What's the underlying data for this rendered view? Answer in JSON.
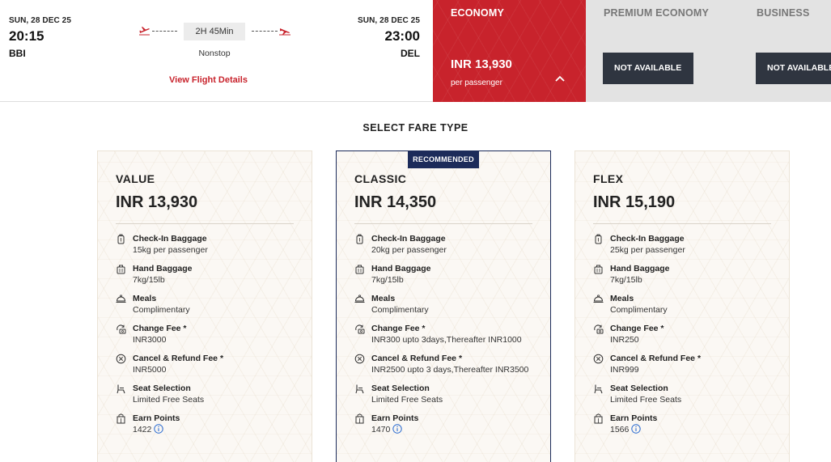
{
  "flight": {
    "departure": {
      "date": "SUN, 28 DEC 25",
      "time": "20:15",
      "code": "BBI"
    },
    "arrival": {
      "date": "SUN, 28 DEC 25",
      "time": "23:00",
      "code": "DEL"
    },
    "duration": "2H 45Min",
    "stops": "Nonstop",
    "details_link": "View Flight Details"
  },
  "classes": {
    "economy": {
      "title": "ECONOMY",
      "price": "INR 13,930",
      "sub": "per passenger"
    },
    "premium": {
      "title": "PREMIUM ECONOMY",
      "button": "NOT AVAILABLE"
    },
    "business": {
      "title": "BUSINESS",
      "button": "NOT AVAILABLE"
    }
  },
  "section_title": "SELECT FARE TYPE",
  "colors": {
    "brand_red": "#c8232c",
    "navy": "#1c2b5a",
    "dark_button": "#2f3540"
  },
  "cards": [
    {
      "name": "VALUE",
      "price": "INR 13,930",
      "badge": "",
      "features": [
        {
          "icon": "bag-icon",
          "label": "Check-In Baggage",
          "value": "15kg per passenger"
        },
        {
          "icon": "hand-bag-icon",
          "label": "Hand Baggage",
          "value": "7kg/15lb"
        },
        {
          "icon": "meal-icon",
          "label": "Meals",
          "value": "Complimentary"
        },
        {
          "icon": "change-fee-icon",
          "label": "Change Fee *",
          "value": "INR3000"
        },
        {
          "icon": "cancel-icon",
          "label": "Cancel & Refund Fee *",
          "value": "INR5000"
        },
        {
          "icon": "seat-icon",
          "label": "Seat Selection",
          "value": "Limited Free Seats"
        },
        {
          "icon": "points-icon",
          "label": "Earn Points",
          "value": "1422"
        }
      ]
    },
    {
      "name": "CLASSIC",
      "price": "INR 14,350",
      "badge": "RECOMMENDED",
      "features": [
        {
          "icon": "bag-icon",
          "label": "Check-In Baggage",
          "value": "20kg per passenger"
        },
        {
          "icon": "hand-bag-icon",
          "label": "Hand Baggage",
          "value": "7kg/15lb"
        },
        {
          "icon": "meal-icon",
          "label": "Meals",
          "value": "Complimentary"
        },
        {
          "icon": "change-fee-icon",
          "label": "Change Fee *",
          "value": "INR300 upto 3days,Thereafter INR1000"
        },
        {
          "icon": "cancel-icon",
          "label": "Cancel & Refund Fee *",
          "value": "INR2500 upto 3 days,Thereafter INR3500"
        },
        {
          "icon": "seat-icon",
          "label": "Seat Selection",
          "value": "Limited Free Seats"
        },
        {
          "icon": "points-icon",
          "label": "Earn Points",
          "value": "1470"
        }
      ]
    },
    {
      "name": "FLEX",
      "price": "INR 15,190",
      "badge": "",
      "features": [
        {
          "icon": "bag-icon",
          "label": "Check-In Baggage",
          "value": "25kg per passenger"
        },
        {
          "icon": "hand-bag-icon",
          "label": "Hand Baggage",
          "value": "7kg/15lb"
        },
        {
          "icon": "meal-icon",
          "label": "Meals",
          "value": "Complimentary"
        },
        {
          "icon": "change-fee-icon",
          "label": "Change Fee *",
          "value": "INR250"
        },
        {
          "icon": "cancel-icon",
          "label": "Cancel & Refund Fee *",
          "value": "INR999"
        },
        {
          "icon": "seat-icon",
          "label": "Seat Selection",
          "value": "Limited Free Seats"
        },
        {
          "icon": "points-icon",
          "label": "Earn Points",
          "value": "1566"
        }
      ]
    }
  ]
}
